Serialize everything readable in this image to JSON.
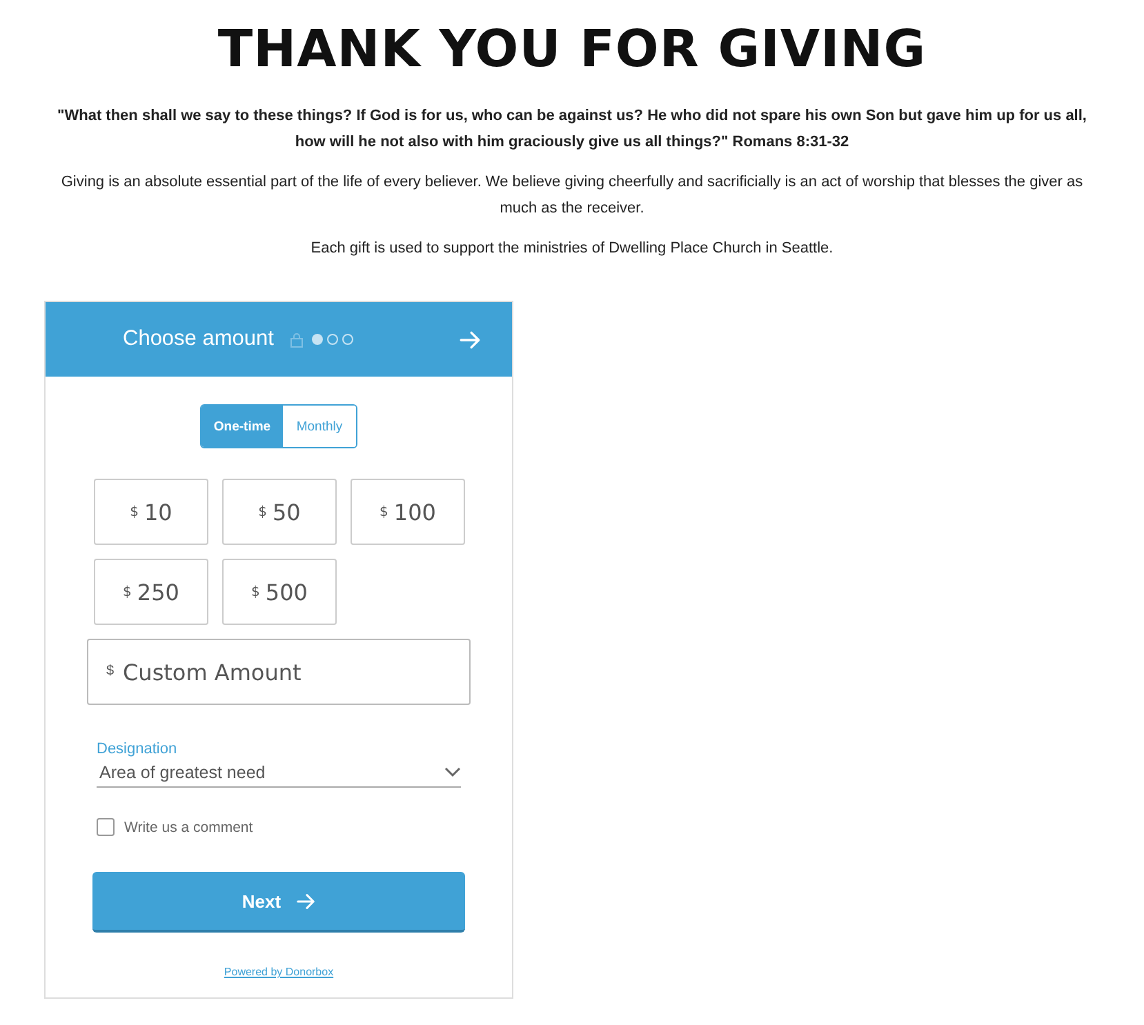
{
  "title": "THANK YOU FOR GIVING",
  "paragraphs": [
    {
      "kind": "quote",
      "text": "\"What then shall we say to these things? If God is for us, who can be against us? He who did not spare his own Son but gave him up for us all, how will he not also with him graciously give us all things?\" Romans 8:31-32"
    },
    {
      "kind": "body",
      "text": "Giving is an absolute essential part of the life of every believer. We believe giving cheerfully and sacrificially is an act of worship that blesses the giver as much as the receiver."
    },
    {
      "kind": "body",
      "text": "Each gift is used to support the ministries of Dwelling Place Church in Seattle."
    }
  ],
  "form": {
    "header": {
      "title": "Choose amount",
      "steps": [
        {
          "selected": true
        },
        {
          "selected": false
        },
        {
          "selected": false
        }
      ]
    },
    "frequency": [
      {
        "label": "One-time",
        "selected": true
      },
      {
        "label": "Monthly",
        "selected": false
      }
    ],
    "amounts": [
      {
        "currency": "$",
        "value": "10"
      },
      {
        "currency": "$",
        "value": "50"
      },
      {
        "currency": "$",
        "value": "100"
      },
      {
        "currency": "$",
        "value": "250"
      },
      {
        "currency": "$",
        "value": "500"
      }
    ],
    "custom_amount": {
      "currency": "$",
      "placeholder": "Custom Amount"
    },
    "designation": {
      "label": "Designation",
      "value": "Area of greatest need"
    },
    "comment": {
      "label": "Write us a comment",
      "checked": false
    },
    "next_button": "Next",
    "footer_link": "Powered by Donorbox"
  }
}
